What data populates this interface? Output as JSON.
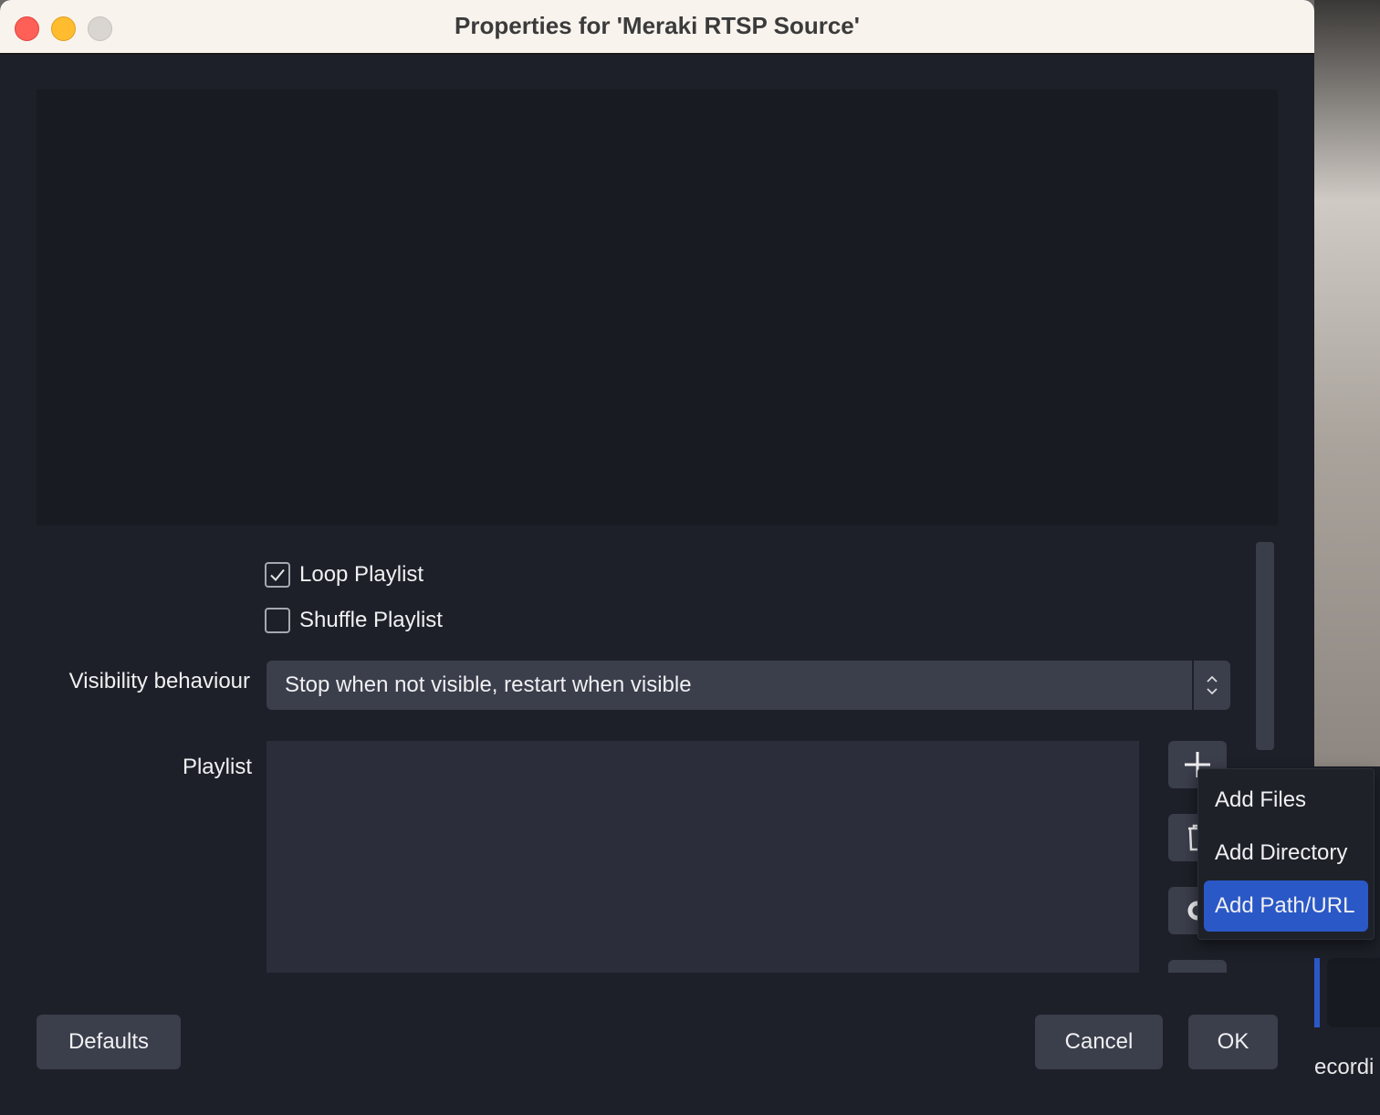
{
  "window": {
    "title": "Properties for 'Meraki RTSP Source'"
  },
  "options": {
    "loop_playlist": {
      "label": "Loop Playlist",
      "checked": true
    },
    "shuffle_playlist": {
      "label": "Shuffle Playlist",
      "checked": false
    }
  },
  "visibility": {
    "label": "Visibility behaviour",
    "value": "Stop when not visible, restart when visible"
  },
  "playlist": {
    "label": "Playlist",
    "items": []
  },
  "add_menu": {
    "items": [
      {
        "label": "Add Files",
        "selected": false
      },
      {
        "label": "Add Directory",
        "selected": false
      },
      {
        "label": "Add Path/URL",
        "selected": true
      }
    ]
  },
  "footer": {
    "defaults_label": "Defaults",
    "cancel_label": "Cancel",
    "ok_label": "OK"
  },
  "background_app": {
    "partial_label": "ecordi"
  },
  "colors": {
    "accent": "#2a58c6",
    "window_bg": "#1e2029",
    "control_bg": "#3b3e4b",
    "titlebar_bg": "#f9f3ee"
  }
}
